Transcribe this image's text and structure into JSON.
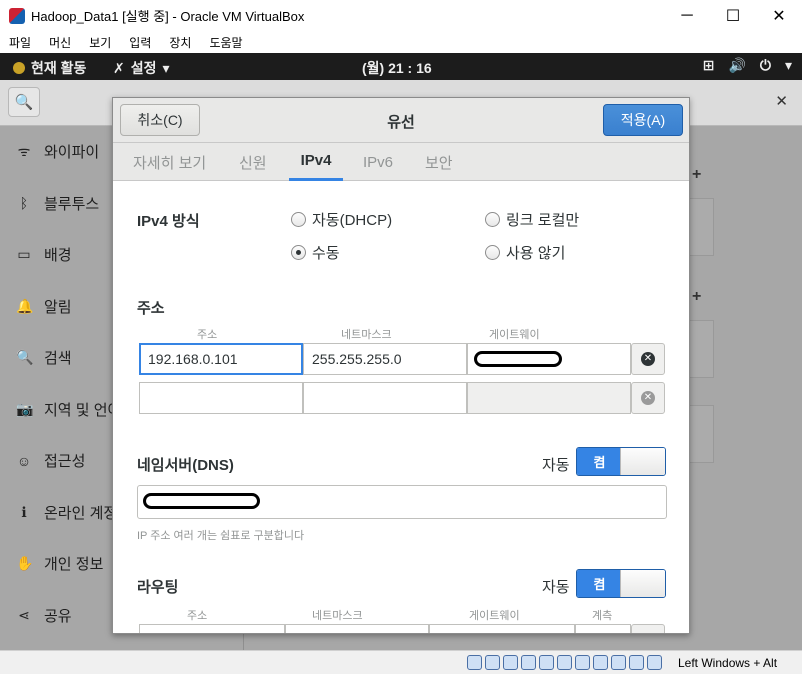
{
  "window": {
    "title": "Hadoop_Data1 [실행 중] - Oracle VM VirtualBox",
    "minimize": "─",
    "maximize": "☐",
    "close": "✕"
  },
  "menu": [
    "파일",
    "머신",
    "보기",
    "입력",
    "장치",
    "도움말"
  ],
  "topbar": {
    "activities": "현재 활동",
    "settings": "설정",
    "settings_arrow": "▾",
    "clock": "(월) 21 : 16",
    "network_icon": "⊞",
    "volume_icon": "🔊",
    "power_icon": "⏻",
    "tray_arrow": "▾"
  },
  "sidebar": {
    "items": [
      {
        "label": "와이파이",
        "icon": "wifi-icon",
        "glyph": "ᯤ"
      },
      {
        "label": "블루투스",
        "icon": "bluetooth-icon",
        "glyph": "ᛒ"
      },
      {
        "label": "배경",
        "icon": "display-icon",
        "glyph": "▭"
      },
      {
        "label": "알림",
        "icon": "bell-icon",
        "glyph": "🔔"
      },
      {
        "label": "검색",
        "icon": "search-icon",
        "glyph": "🔍"
      },
      {
        "label": "지역 및 언어",
        "icon": "camera-icon",
        "glyph": "📷"
      },
      {
        "label": "접근성",
        "icon": "accessibility-icon",
        "glyph": "☺"
      },
      {
        "label": "온라인 계정",
        "icon": "online-accounts-icon",
        "glyph": "ℹ"
      },
      {
        "label": "개인 정보",
        "icon": "hand-icon",
        "glyph": "✋"
      },
      {
        "label": "공유",
        "icon": "share-icon",
        "glyph": "⋖"
      }
    ]
  },
  "dialog": {
    "cancel": "취소(C)",
    "title": "유선",
    "apply": "적용(A)",
    "tabs": [
      "자세히 보기",
      "신원",
      "IPv4",
      "IPv6",
      "보안"
    ],
    "active_tab": "IPv4",
    "method": {
      "label": "IPv4 방식",
      "options": [
        "자동(DHCP)",
        "링크 로컬만",
        "수동",
        "사용 않기"
      ],
      "selected": "수동"
    },
    "address": {
      "label": "주소",
      "col_address": "주소",
      "col_netmask": "네트마스크",
      "col_gateway": "게이트웨이",
      "row1": {
        "address": "192.168.0.101",
        "netmask": "255.255.255.0"
      },
      "row2": {
        "address": "",
        "netmask": ""
      }
    },
    "dns": {
      "label": "네임서버(DNS)",
      "auto_label": "자동",
      "switch_on": "켬",
      "hint": "IP 주소 여러 개는 쉼표로 구분합니다"
    },
    "routing": {
      "label": "라우팅",
      "auto_label": "자동",
      "switch_on": "켬",
      "col_address": "주소",
      "col_netmask": "네트마스크",
      "col_gateway": "게이트웨이",
      "col_metric": "계측"
    }
  },
  "statusbar": {
    "host_key": "Left Windows + Alt"
  },
  "colors": {
    "accent": "#3584e4",
    "topbar": "#1c1c1c",
    "dimmed_bg": "#a7a7a7"
  }
}
